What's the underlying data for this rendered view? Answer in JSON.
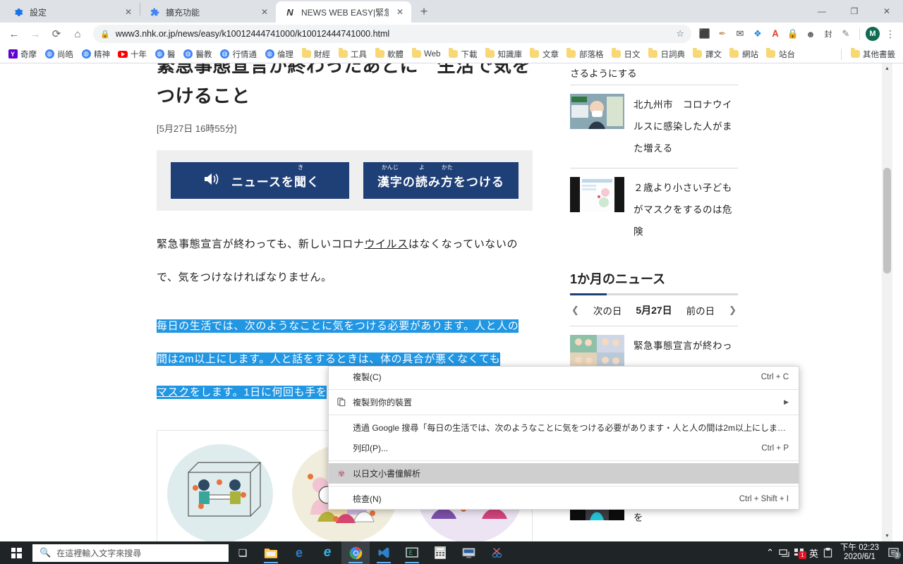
{
  "browser": {
    "tabs": [
      {
        "title": "設定",
        "icon": "gear-icon",
        "active": false
      },
      {
        "title": "擴充功能",
        "icon": "puzzle-icon",
        "active": false
      },
      {
        "title": "NEWS WEB EASY|緊急事態宣言",
        "icon": "nhk-icon",
        "active": true
      }
    ],
    "new_tab_label": "+",
    "window_controls": {
      "minimize": "—",
      "maximize": "❐",
      "close": "✕"
    },
    "nav": {
      "back": "←",
      "forward": "→",
      "reload": "⟳",
      "home": "⌂"
    },
    "omnibox": {
      "lock_icon": "lock-icon",
      "url": "www3.nhk.or.jp/news/easy/k10012444741000/k10012444741000.html",
      "star_icon": "☆"
    },
    "extensions": [
      {
        "name": "screenshot-extension",
        "glyph": "▣"
      },
      {
        "name": "eyedropper-extension",
        "glyph": "✎"
      },
      {
        "name": "mail-extension",
        "glyph": "✉"
      },
      {
        "name": "dropbox-extension",
        "glyph": "❖"
      },
      {
        "name": "adobe-acrobat-extension",
        "glyph": "人"
      },
      {
        "name": "lastpass-extension",
        "glyph": "▲"
      },
      {
        "name": "chat-extension",
        "glyph": "◯"
      },
      {
        "name": "seal-extension",
        "glyph": "封"
      },
      {
        "name": "magnifier-extension",
        "glyph": "✒"
      }
    ],
    "profile_initial": "M",
    "menu_glyph": "⋮",
    "bookmarks": [
      {
        "label": "奇摩",
        "icon": "yahoo-icon"
      },
      {
        "label": "尚皓",
        "icon": "globe-icon"
      },
      {
        "label": "精神",
        "icon": "globe-icon"
      },
      {
        "label": "十年",
        "icon": "youtube-icon"
      },
      {
        "label": "醫",
        "icon": "globe-icon"
      },
      {
        "label": "醫教",
        "icon": "globe-icon"
      },
      {
        "label": "行情通",
        "icon": "globe-icon"
      },
      {
        "label": "倫理",
        "icon": "globe-icon"
      },
      {
        "label": "財經",
        "icon": "folder-icon"
      },
      {
        "label": "工具",
        "icon": "folder-icon"
      },
      {
        "label": "軟體",
        "icon": "folder-icon"
      },
      {
        "label": "Web",
        "icon": "folder-icon"
      },
      {
        "label": "下載",
        "icon": "folder-icon"
      },
      {
        "label": "知識庫",
        "icon": "folder-icon"
      },
      {
        "label": "文章",
        "icon": "folder-icon"
      },
      {
        "label": "部落格",
        "icon": "folder-icon"
      },
      {
        "label": "日文",
        "icon": "folder-icon"
      },
      {
        "label": "日詞典",
        "icon": "folder-icon"
      },
      {
        "label": "譯文",
        "icon": "folder-icon"
      },
      {
        "label": "網站",
        "icon": "folder-icon"
      },
      {
        "label": "站台",
        "icon": "folder-icon"
      }
    ],
    "other_bookmarks": {
      "label": "其他書籤",
      "icon": "folder-icon"
    }
  },
  "article": {
    "headline": "緊急事態宣言が終わったあとに　生活で気をつけること",
    "date": "[5月27日 16時55分]",
    "buttons": {
      "listen": {
        "label": "ニュースを聞く",
        "ruby": "き",
        "icon": "speaker-icon"
      },
      "furigana": {
        "label": "漢字の読み方をつける",
        "ruby1": "かんじ",
        "ruby2": "よ",
        "ruby3": "かた"
      }
    },
    "paragraph1_a": "緊急事態宣言が終わっても、新しいコロナ",
    "paragraph1_link": "ウイルス",
    "paragraph1_b": "はなくなっていないの",
    "paragraph1_c": "で、気をつけなければなりません。",
    "paragraph2_line1": "毎日の生活では、次のようなことに気をつける必要があります。人と人の",
    "paragraph2_line2": "間は2m以上にします。人と話をするときは、体の具合が悪くなくても",
    "paragraph2_link": "マスク",
    "paragraph2_line3": "をします。1日に何回も手を"
  },
  "sidebar": {
    "top_partial_text": "さるようにする",
    "items": [
      {
        "title": "北九州市　コロナウイルスに感染した人がまた増える",
        "thumb": "press-conference-photo"
      },
      {
        "title": "２歳より小さい子どもがマスクをするのは危険",
        "thumb": "poster-photo"
      }
    ],
    "section_title": "1か月のニュース",
    "daynav": {
      "prev_chevron": "❮",
      "prev_label": "次の日",
      "date": "5月27日",
      "next_label": "前の日",
      "next_chevron": "❯"
    },
    "month_items": [
      {
        "title": "緊急事態宣言が終わっ",
        "thumb": "illustration-photo"
      }
    ],
    "bottom_items": [
      {
        "title": "インターネットの悪口を",
        "thumb": "singer-photo"
      }
    ]
  },
  "context_menu": {
    "items": [
      {
        "label": "複製(C)",
        "accel": "Ctrl + C",
        "icon": "",
        "submenu": false,
        "highlight": false
      },
      {
        "label": "複製到你的裝置",
        "accel": "",
        "icon": "device-icon",
        "submenu": true,
        "highlight": false
      },
      {
        "label": "透過 Google 搜尋「每日の生活では、次のようなことに気をつける必要があります・人と人の間は2m以上にします・...",
        "accel": "",
        "icon": "",
        "submenu": false,
        "highlight": false
      },
      {
        "label": "列印(P)...",
        "accel": "Ctrl + P",
        "icon": "",
        "submenu": false,
        "highlight": false
      },
      {
        "label": "以日文小書僮解析",
        "accel": "",
        "icon": "extension-icon",
        "submenu": false,
        "highlight": true
      },
      {
        "label": "檢查(N)",
        "accel": "Ctrl + Shift + I",
        "icon": "",
        "submenu": false,
        "highlight": false
      }
    ]
  },
  "taskbar": {
    "start_label": "start-button",
    "search_placeholder": "在這裡輸入文字來搜尋",
    "search_icon": "search-icon",
    "items": [
      {
        "name": "task-view",
        "glyph": "❏"
      },
      {
        "name": "file-explorer",
        "glyph": "🗀"
      },
      {
        "name": "edge-chromium",
        "glyph": "e"
      },
      {
        "name": "edge-legacy",
        "glyph": "e"
      },
      {
        "name": "chrome",
        "glyph": "◉"
      },
      {
        "name": "vscode",
        "glyph": "◢"
      },
      {
        "name": "terminal-app",
        "glyph": "▣"
      },
      {
        "name": "calculator",
        "glyph": "▦"
      },
      {
        "name": "remote-desktop",
        "glyph": "▤"
      },
      {
        "name": "snipping-tool",
        "glyph": "✂"
      }
    ],
    "tray": {
      "up_chevron": "⌃",
      "network_icon": "network-icon",
      "ime_icon": "ime-icon",
      "ime_badge": "1",
      "language": "英",
      "clipboard_icon": "clipboard-icon",
      "time": "下午 02:23",
      "date": "2020/6/1",
      "notification_icon": "notification-icon",
      "notification_badge": "3"
    }
  },
  "colors": {
    "nhk_blue": "#1f3f77",
    "selection_blue": "#2196e3",
    "chrome_gray": "#dee1e6",
    "taskbar": "#1f2427"
  }
}
